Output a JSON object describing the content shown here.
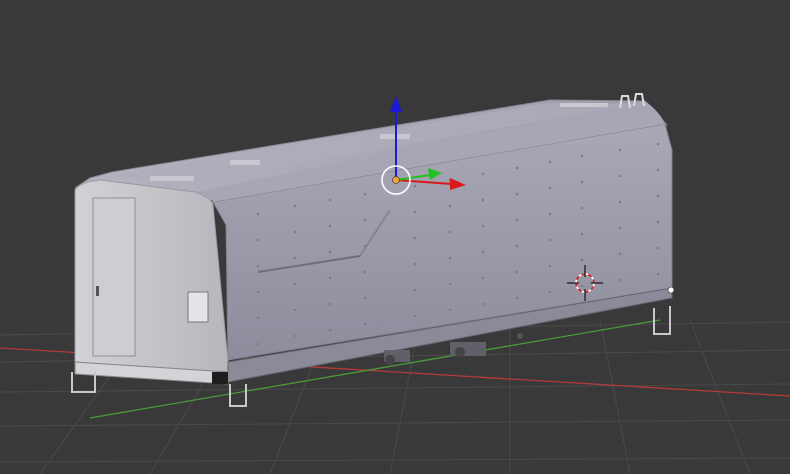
{
  "viewport": {
    "background_color": "#393939",
    "grid_color": "#4a4a4a",
    "x_axis_color": "#b43a3a",
    "y_axis_color": "#4a9a3a"
  },
  "scene": {
    "selected_object": "boxcar",
    "body_color": "#9a9aa8",
    "end_face_color": "#c2c2c6",
    "roof_color": "#a4a4b2"
  },
  "gizmo": {
    "z_handle_color": "#1a1ad8",
    "y_handle_color": "#22c022",
    "x_handle_color": "#d81a1a",
    "origin_color": "#f2a23c",
    "icons": [
      "translate-gizmo-icon",
      "3d-cursor-icon"
    ]
  }
}
